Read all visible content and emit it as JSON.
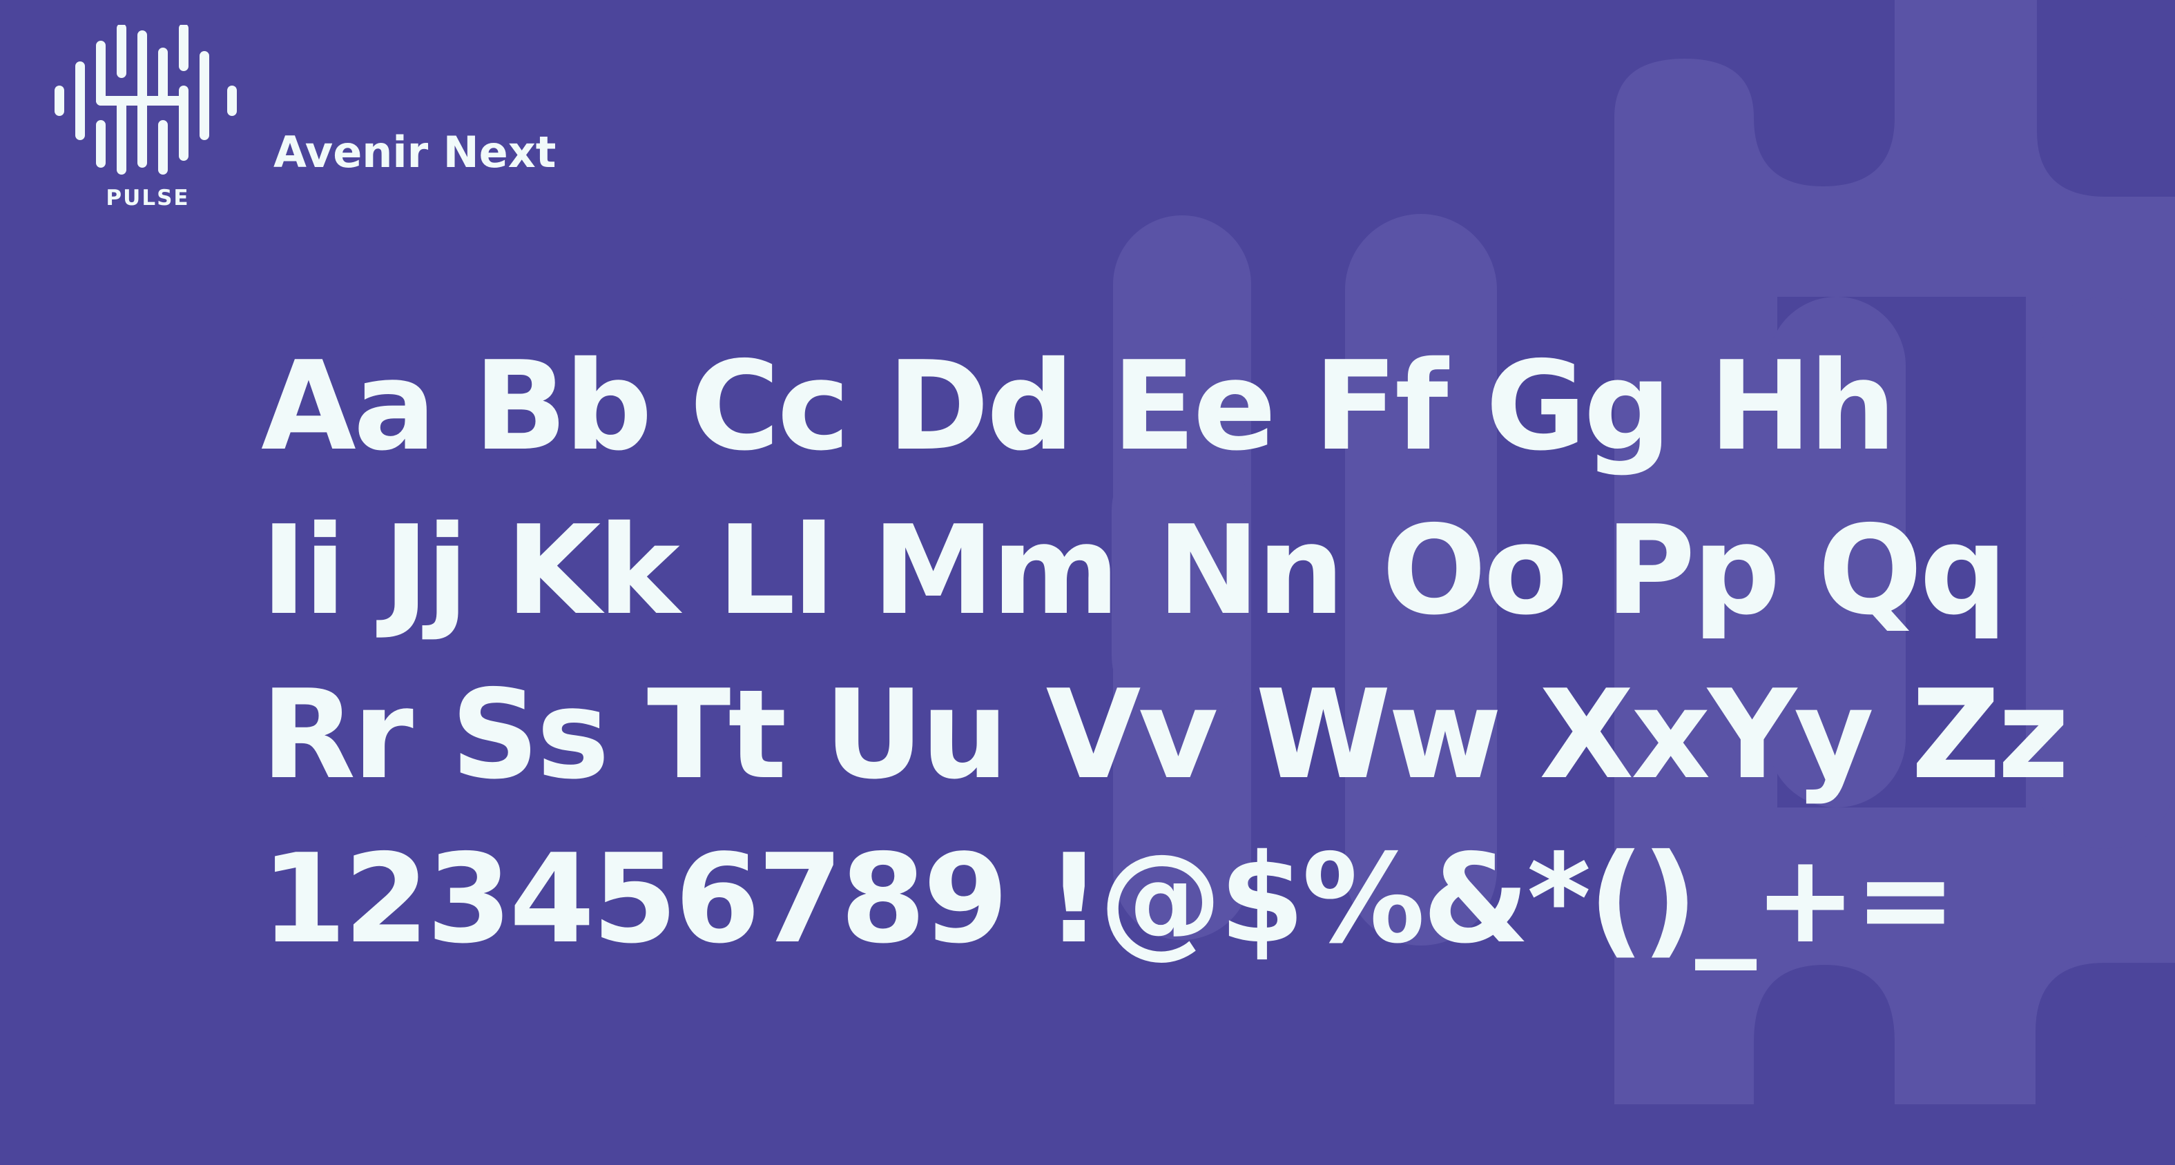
{
  "brand": {
    "logo_icon": "pulse-waveform-icon",
    "logo_label": "PULSE"
  },
  "font_name": "Avenir Next",
  "specimen": {
    "lines": [
      "Aa Bb Cc Dd Ee Ff Gg Hh",
      "Ii Jj Kk Ll Mm Nn Oo Pp Qq",
      "Rr Ss Tt Uu Vv Ww XxYy Zz",
      "123456789 !@$%&*()_+="
    ]
  },
  "colors": {
    "background": "#4c459b",
    "text": "#f1fafa",
    "background_shape": "#5c55a6"
  }
}
